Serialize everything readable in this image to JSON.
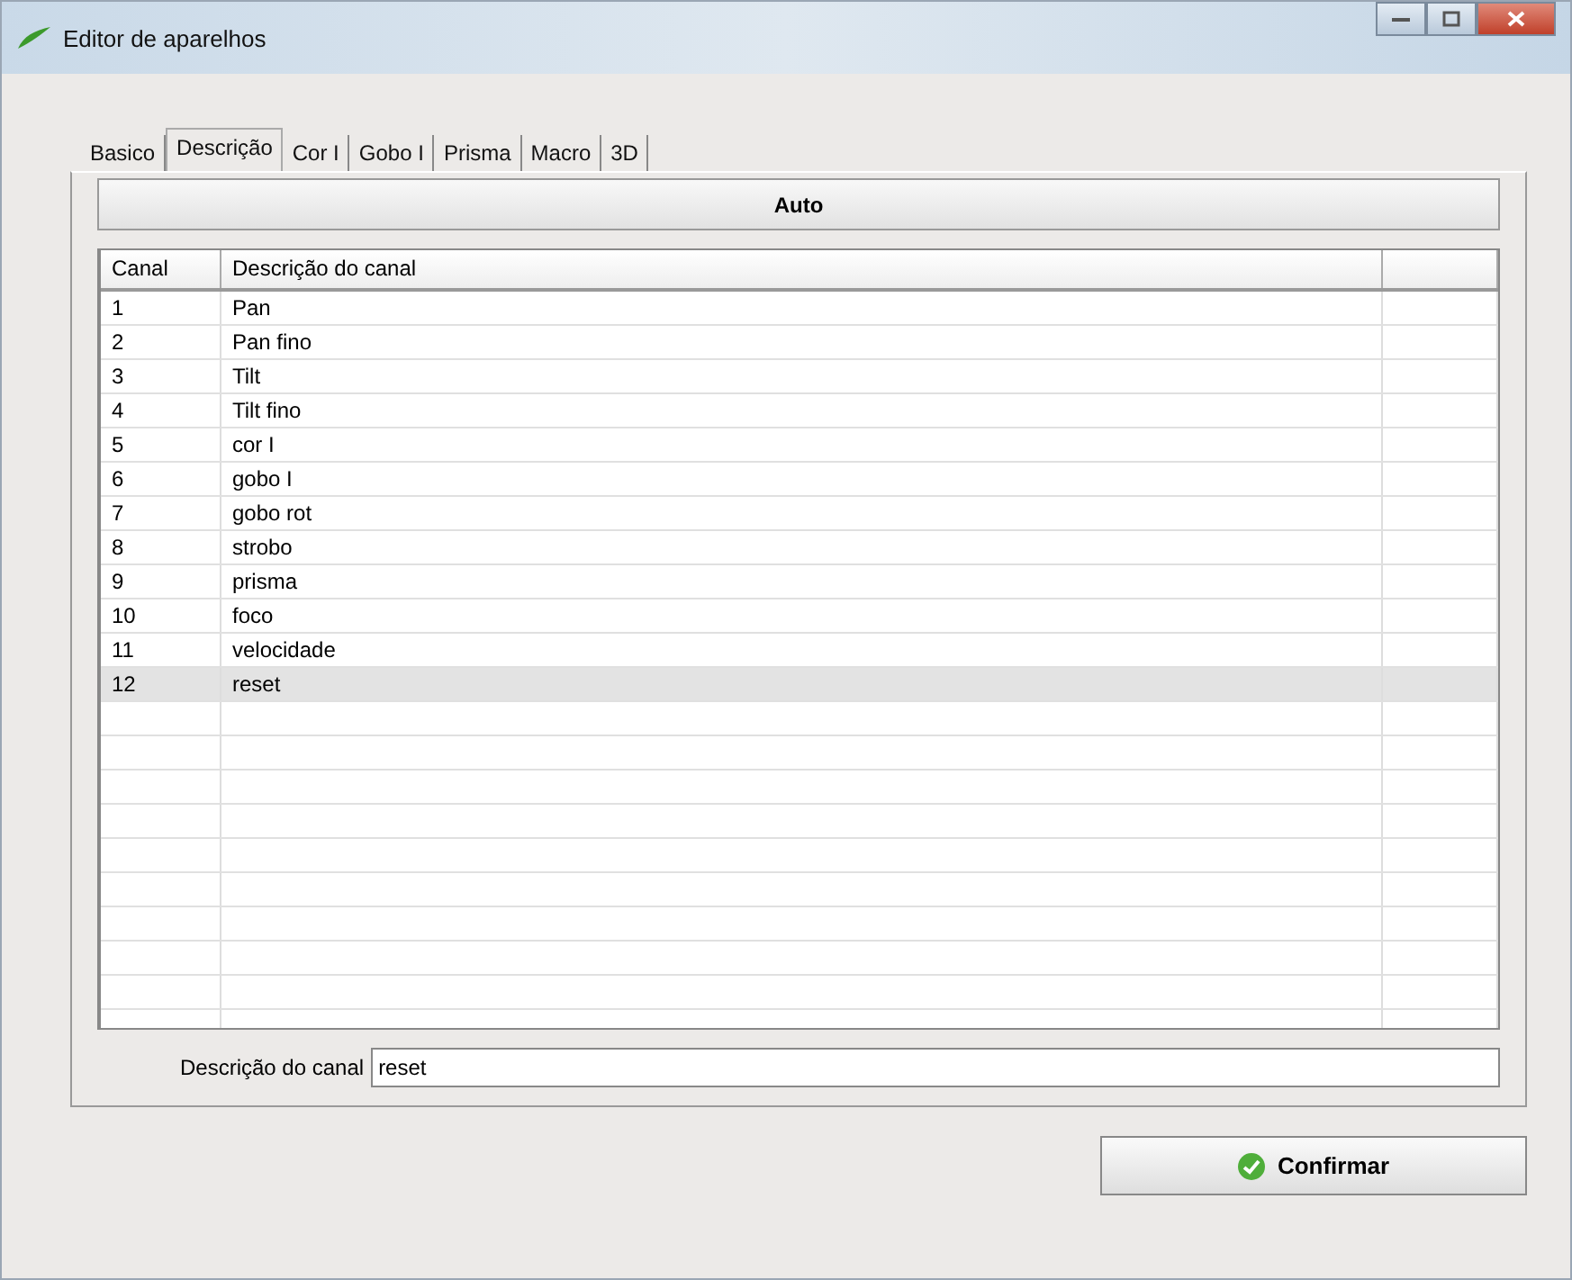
{
  "window": {
    "title": "Editor de aparelhos"
  },
  "tabs": [
    {
      "label": "Basico",
      "selected": false
    },
    {
      "label": "Descrição",
      "selected": true
    },
    {
      "label": "Cor I",
      "selected": false
    },
    {
      "label": "Gobo I",
      "selected": false
    },
    {
      "label": "Prisma",
      "selected": false
    },
    {
      "label": "Macro",
      "selected": false
    },
    {
      "label": "3D",
      "selected": false
    }
  ],
  "auto_button": "Auto",
  "table": {
    "columns": [
      "Canal",
      "Descrição do canal"
    ],
    "rows": [
      {
        "canal": "1",
        "descricao": "Pan",
        "selected": false
      },
      {
        "canal": "2",
        "descricao": "Pan fino",
        "selected": false
      },
      {
        "canal": "3",
        "descricao": "Tilt",
        "selected": false
      },
      {
        "canal": "4",
        "descricao": "Tilt fino",
        "selected": false
      },
      {
        "canal": "5",
        "descricao": "cor I",
        "selected": false
      },
      {
        "canal": "6",
        "descricao": "gobo I",
        "selected": false
      },
      {
        "canal": "7",
        "descricao": "gobo rot",
        "selected": false
      },
      {
        "canal": "8",
        "descricao": "strobo",
        "selected": false
      },
      {
        "canal": "9",
        "descricao": "prisma",
        "selected": false
      },
      {
        "canal": "10",
        "descricao": "foco",
        "selected": false
      },
      {
        "canal": "11",
        "descricao": "velocidade",
        "selected": false
      },
      {
        "canal": "12",
        "descricao": "reset",
        "selected": true
      }
    ]
  },
  "description_field": {
    "label": "Descrição do canal",
    "value": "reset"
  },
  "confirm_button": "Confirmar"
}
